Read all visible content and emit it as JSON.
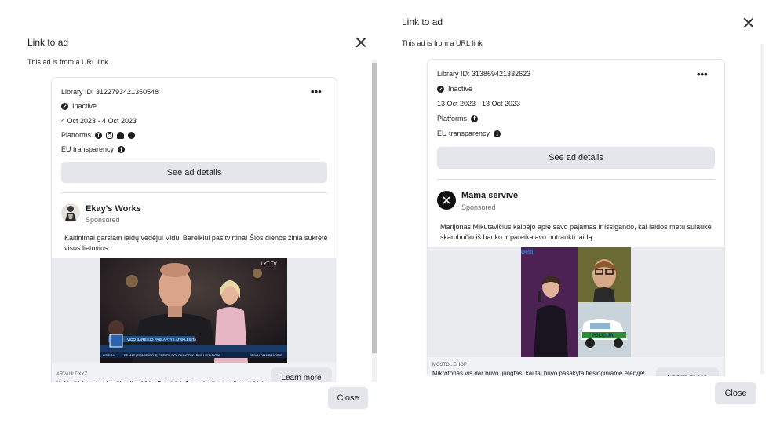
{
  "left": {
    "title": "Link to ad",
    "subtitle": "This ad is from a URL link",
    "library_id": "Library ID: 3122793421350548",
    "status": "Inactive",
    "dates": "4 Oct 2023 - 4 Oct 2023",
    "platforms_label": "Platforms",
    "platform_icons": [
      "facebook-icon",
      "instagram-icon",
      "audience-network-icon",
      "messenger-icon"
    ],
    "eu_label": "EU transparency",
    "details_button": "See ad details",
    "page_name": "Ekay's Works",
    "sponsored": "Sponsored",
    "body": "Kaltinimai garsiam laidų vedėjui Vidui Bareikiui pasitvirtina! Šios dienos žinia sukrėtė visus lietuvius",
    "media_caption_tag": "LYT TV",
    "media_ticker_1": "VIDO BAREIKIO PASLAPTYS ATSKLEISTA",
    "media_ticker_2": "ESAME ĮSIPAREIGOJĘ GREITAI DOLOKIUOTI KARUS LIETUVOJE",
    "media_ticker_3": "PRIVALOMA PRADINE",
    "media_ticker_badge": "LIETUVA",
    "footer_domain": "ARVAULT.XYZ",
    "footer_text": "Kokia liūdna pabaiga šiandien Vidui Bareikiui. Jo paslaptis pagaliau atskleista",
    "learn_more": "Learn more",
    "close_button": "Close"
  },
  "right": {
    "title": "Link to ad",
    "subtitle": "This ad is from a URL link",
    "library_id": "Library ID: 313869421332623",
    "status": "Inactive",
    "dates": "13 Oct 2023 - 13 Oct 2023",
    "platforms_label": "Platforms",
    "platform_icons": [
      "facebook-icon"
    ],
    "eu_label": "EU transparency",
    "details_button": "See ad details",
    "page_name": "Mama servive",
    "sponsored": "Sponsored",
    "body": "Marijonas Mikutavičius kalbėjo apie savo pajamas ir išsigando, kai laidos metu sulaukė skambučio iš banko ir pareikalavo nutraukti laidą.",
    "media_brand": "Delfi",
    "media_police": "POLICIJA",
    "footer_domain": "MOSTOL.SHOP",
    "footer_text": "Mikrofonas vis dar buvo įjungtas, kai tai buvo pasakyta tiesioginiame eteryje!",
    "learn_more": "Learn more",
    "close_button": "Close"
  }
}
